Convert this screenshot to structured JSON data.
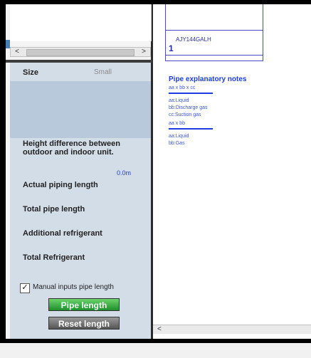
{
  "left": {
    "size": {
      "label": "Size",
      "value": "Small"
    },
    "height_diff": {
      "label_line1": "Height difference between",
      "label_line2": "outdoor and indoor unit.",
      "value": "0.0m"
    },
    "actual_piping_length": {
      "label": "Actual piping length"
    },
    "total_pipe_length": {
      "label": "Total pipe length"
    },
    "additional_refrigerant": {
      "label": "Additional refrigerant"
    },
    "total_refrigerant": {
      "label": "Total Refrigerant"
    },
    "manual_inputs": {
      "label": "Manual inputs pipe length",
      "checked": true,
      "check_glyph": "✓"
    },
    "buttons": {
      "pipe_length": "Pipe length",
      "reset_length": "Reset length"
    },
    "scroll_left_arrow": "<",
    "scroll_right_arrow": ">"
  },
  "right": {
    "unit": {
      "model": "AJY144GALH",
      "number": "1"
    },
    "notes": {
      "title": "Pipe explanatory notes",
      "group1_header": "aa x bb x cc",
      "group1_items": [
        "aa:Liquid",
        "bb:Discharge gas",
        "cc:Suction gas"
      ],
      "group2_header": "aa x bb",
      "group2_items": [
        "aa:Liquid",
        "bb:Gas"
      ]
    },
    "scroll_left_arrow": "<"
  },
  "colors": {
    "panel_bg": "#d3dde8",
    "accent_blue": "#1a3ee0",
    "pipe_button": "#1f8f2a",
    "reset_button": "#555555"
  }
}
